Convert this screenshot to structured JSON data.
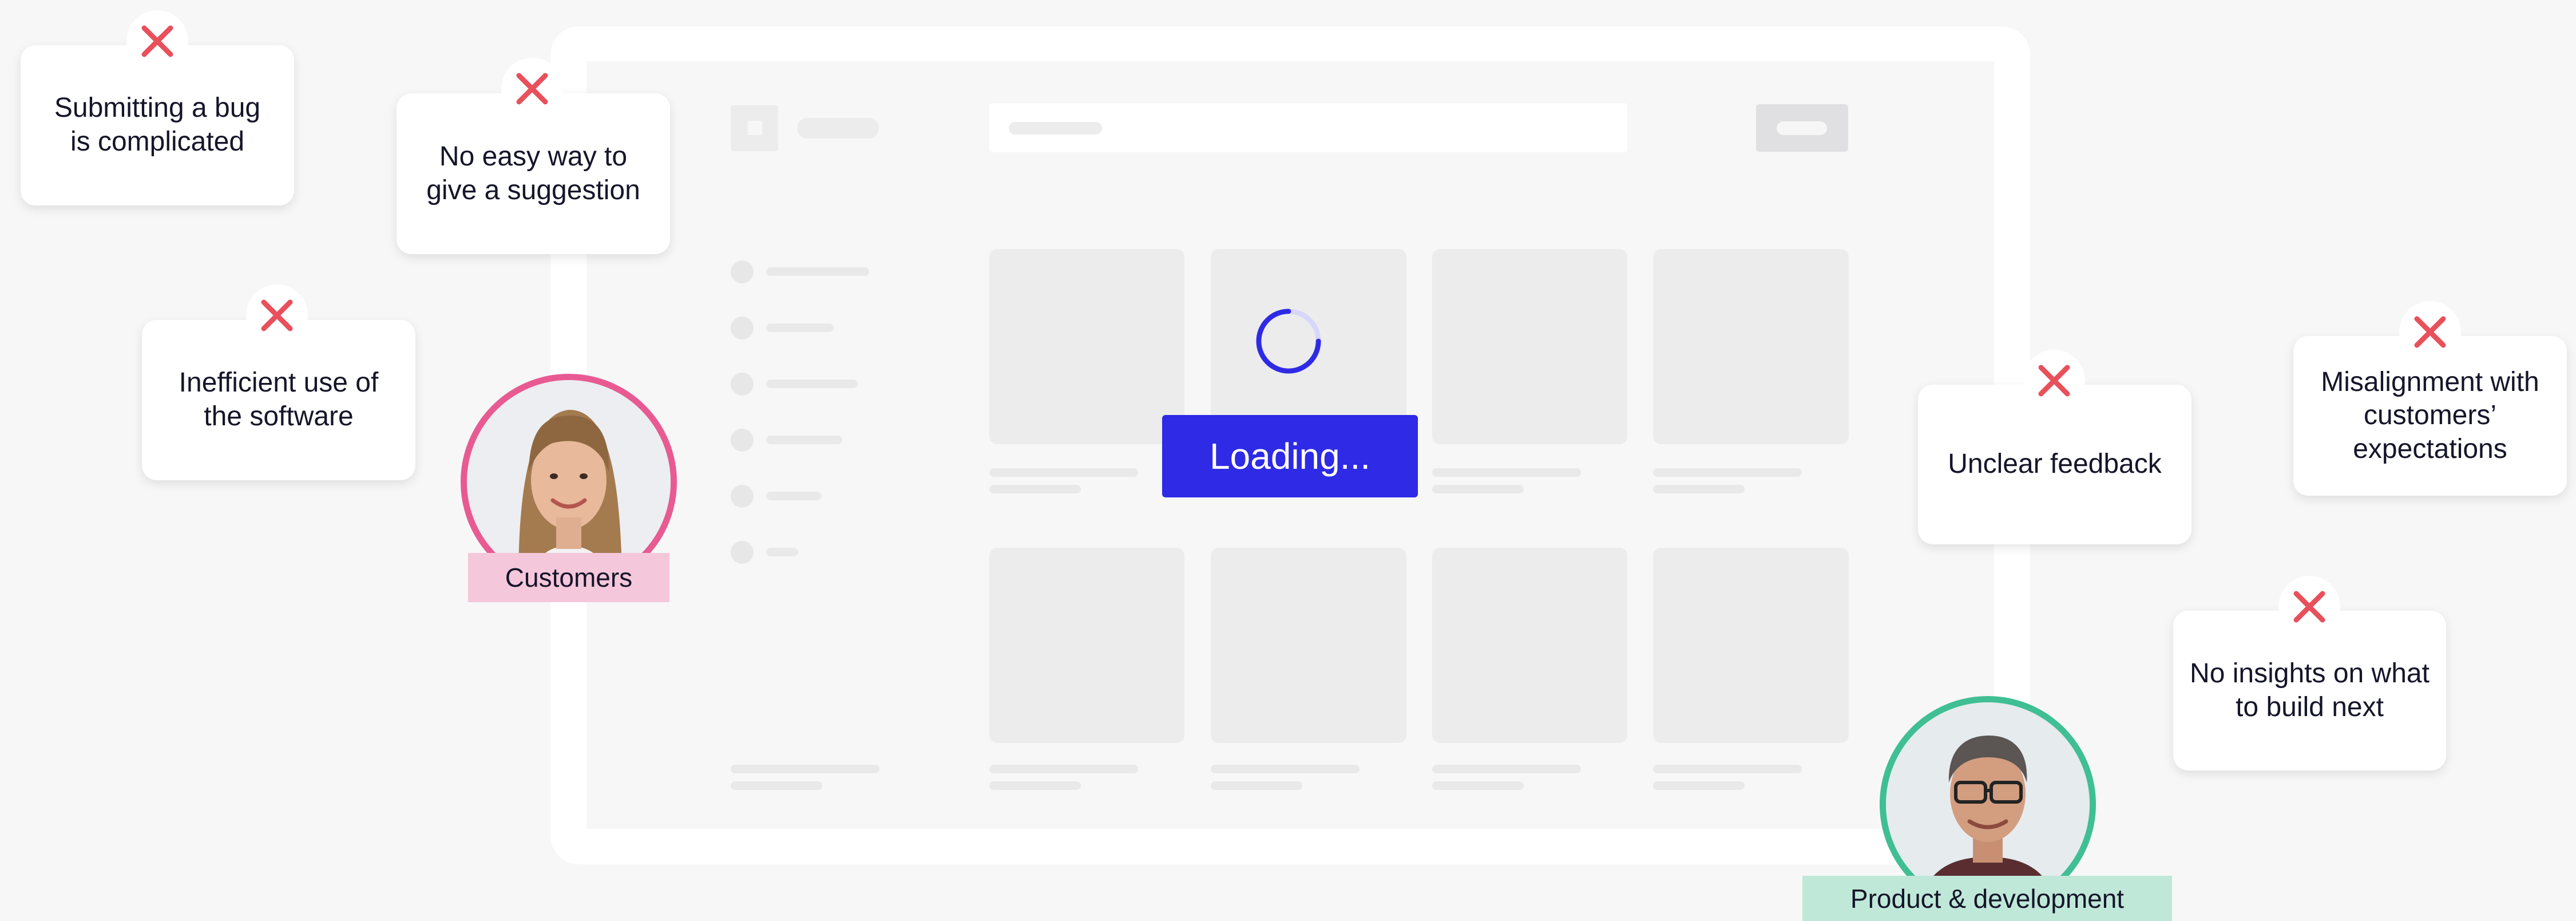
{
  "loading": {
    "label": "Loading..."
  },
  "pain_points": [
    {
      "text": "Submitting a bug is complicated"
    },
    {
      "text": "No easy way to give a suggestion"
    },
    {
      "text": "Inefficient use of the software"
    },
    {
      "text": "Unclear feedback"
    },
    {
      "text": "Misalignment with customers’ expectations"
    },
    {
      "text": "No insights on what to build next"
    }
  ],
  "personas": {
    "customers": {
      "label": "Customers",
      "ring_color": "#e85a92",
      "tag_color": "#f5c7da"
    },
    "product": {
      "label": "Product & development",
      "ring_color": "#3fbf93",
      "tag_color": "#bfe8d8"
    }
  },
  "colors": {
    "accent": "#2e2ae6",
    "error": "#e8505b"
  }
}
